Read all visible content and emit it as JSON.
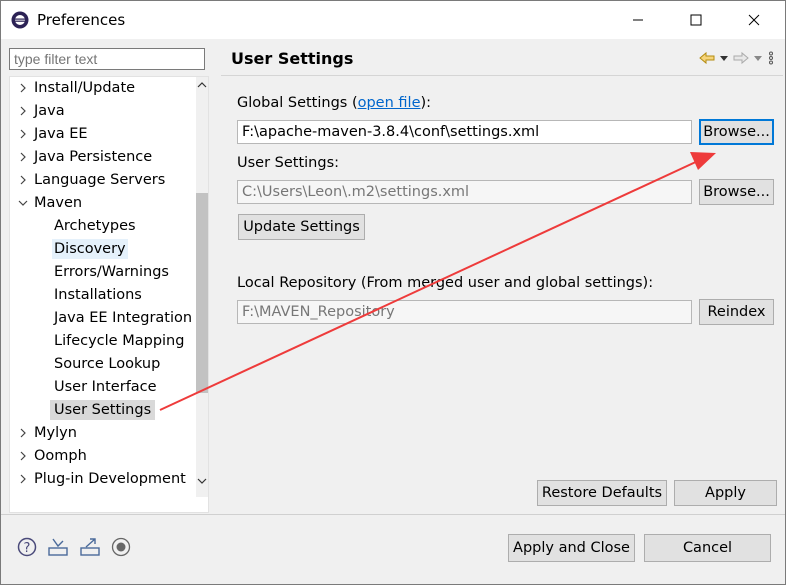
{
  "window": {
    "title": "Preferences"
  },
  "filter": {
    "placeholder": "type filter text"
  },
  "tree": {
    "items": [
      {
        "label": "Install/Update"
      },
      {
        "label": "Java"
      },
      {
        "label": "Java EE"
      },
      {
        "label": "Java Persistence"
      },
      {
        "label": "Language Servers"
      },
      {
        "label": "Maven"
      },
      {
        "label": "Archetypes"
      },
      {
        "label": "Discovery"
      },
      {
        "label": "Errors/Warnings"
      },
      {
        "label": "Installations"
      },
      {
        "label": "Java EE Integration"
      },
      {
        "label": "Lifecycle Mapping"
      },
      {
        "label": "Source Lookup"
      },
      {
        "label": "User Interface"
      },
      {
        "label": "User Settings"
      },
      {
        "label": "Mylyn"
      },
      {
        "label": "Oomph"
      },
      {
        "label": "Plug-in Development"
      }
    ]
  },
  "page": {
    "title": "User Settings",
    "global_label_prefix": "Global Settings (",
    "global_link": "open file",
    "global_label_suffix": "):",
    "global_value": "F:\\apache-maven-3.8.4\\conf\\settings.xml",
    "browse_label": "Browse...",
    "user_label": "User Settings:",
    "user_value": "C:\\Users\\Leon\\.m2\\settings.xml",
    "update_label": "Update Settings",
    "local_label": "Local Repository (From merged user and global settings):",
    "local_value": "F:\\MAVEN_Repository",
    "reindex_label": "Reindex",
    "restore_label": "Restore Defaults",
    "apply_label": "Apply"
  },
  "footer": {
    "apply_close_label": "Apply and Close",
    "cancel_label": "Cancel"
  },
  "colors": {
    "accent": "#0078d7",
    "annotation": "#ee3b3b",
    "link": "#0066cc"
  }
}
